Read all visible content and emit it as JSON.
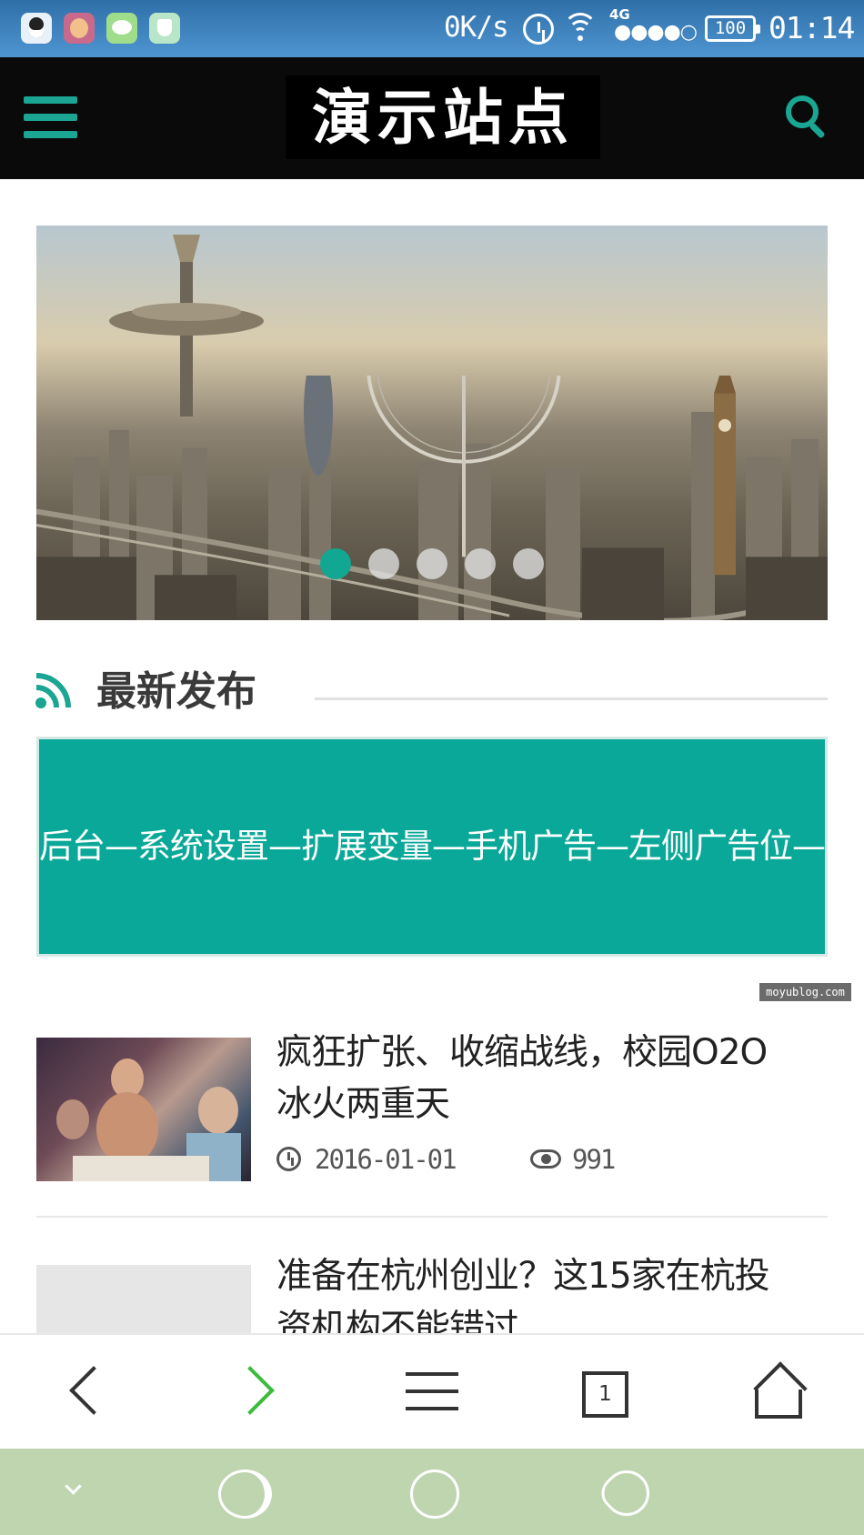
{
  "statusbar": {
    "net_speed": "0K/s",
    "network_type": "4G",
    "signal_dots": "●●●●○",
    "battery": "100",
    "time": "01:14",
    "apps": [
      "qq-icon",
      "game-app-icon",
      "wechat-icon",
      "security-shield-icon"
    ]
  },
  "header": {
    "logo_text": "演示站点",
    "menu_icon": "hamburger-menu-icon",
    "search_icon": "search-icon",
    "accent_color": "#1aa692"
  },
  "slider": {
    "image_description_icon": "city-skyline-image",
    "slide_count": 5,
    "active_slide": 1
  },
  "section": {
    "title": "最新发布",
    "icon": "rss-icon"
  },
  "ad": {
    "text": "后台—系统设置—扩展变量—手机广告—左侧广告位—",
    "color": "#0aa898"
  },
  "watermark": "moyublog.com",
  "articles": [
    {
      "title_line1": "疯狂扩张、收缩战线，校园O2O",
      "title_line2": "冰火两重天",
      "date": "2016-01-01",
      "views": "991"
    },
    {
      "title_line1": "准备在杭州创业？这15家在杭投",
      "title_line2": "资机构不能错过"
    }
  ],
  "browser_toolbar": {
    "tab_count": "1",
    "forward_color": "#3cbb3c"
  },
  "android_nav": {
    "bg_color": "#bed5b0"
  }
}
